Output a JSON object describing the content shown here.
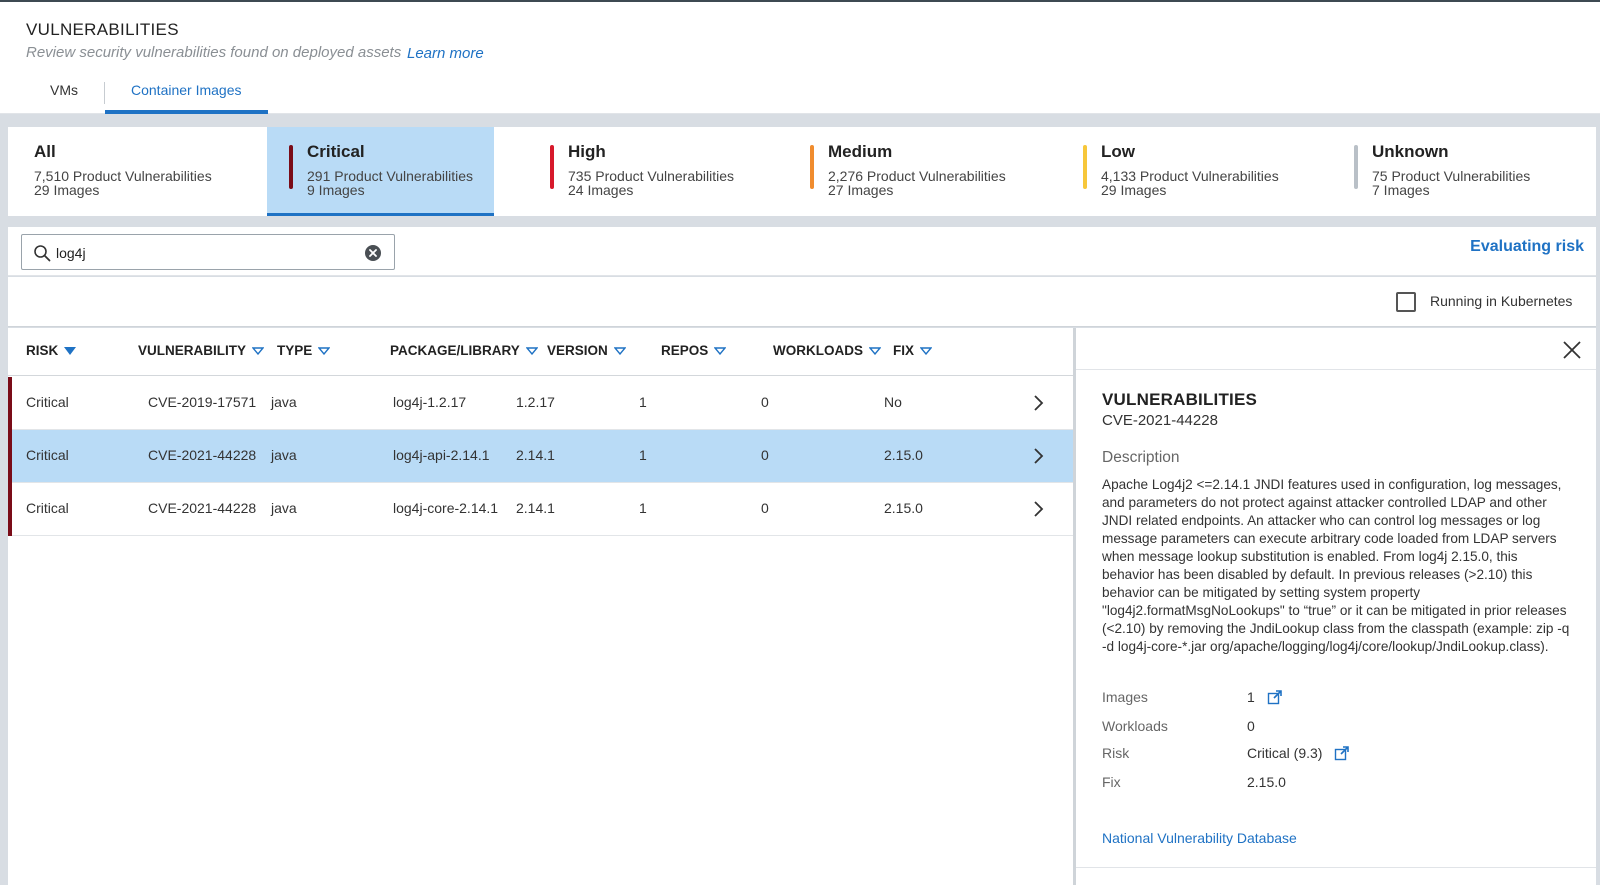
{
  "header": {
    "title": "VULNERABILITIES",
    "subtitle": "Review security vulnerabilities found on deployed assets",
    "learn_more": "Learn more"
  },
  "tabs": [
    {
      "label": "VMs",
      "active": false
    },
    {
      "label": "Container Images",
      "active": true
    }
  ],
  "severity_cards": [
    {
      "name": "All",
      "line1": "7,510 Product Vulnerabilities",
      "line2": "29 Images",
      "color": "",
      "selected": false
    },
    {
      "name": "Critical",
      "line1": "291 Product Vulnerabilities",
      "line2": "9 Images",
      "color": "#7a0c18",
      "selected": true
    },
    {
      "name": "High",
      "line1": "735 Product Vulnerabilities",
      "line2": "24 Images",
      "color": "#d7192b",
      "selected": false
    },
    {
      "name": "Medium",
      "line1": "2,276 Product Vulnerabilities",
      "line2": "27 Images",
      "color": "#f08c2e",
      "selected": false
    },
    {
      "name": "Low",
      "line1": "4,133 Product Vulnerabilities",
      "line2": "29 Images",
      "color": "#f7c73a",
      "selected": false
    },
    {
      "name": "Unknown",
      "line1": "75 Product Vulnerabilities",
      "line2": "7 Images",
      "color": "#b9c0c7",
      "selected": false
    }
  ],
  "search": {
    "value": "log4j",
    "placeholder": ""
  },
  "evaluating_risk": "Evaluating risk",
  "filters": {
    "running_in_kubernetes": "Running in Kubernetes"
  },
  "table": {
    "headers": {
      "risk": "RISK",
      "vulnerability": "VULNERABILITY",
      "type": "TYPE",
      "package": "PACKAGE/LIBRARY",
      "version": "VERSION",
      "repos": "REPOS",
      "workloads": "WORKLOADS",
      "fix": "FIX"
    },
    "rows": [
      {
        "risk": "Critical",
        "vulnerability": "CVE-2019-17571",
        "type": "java",
        "package": "log4j-1.2.17",
        "version": "1.2.17",
        "repos": "1",
        "workloads": "0",
        "fix": "No",
        "selected": false
      },
      {
        "risk": "Critical",
        "vulnerability": "CVE-2021-44228",
        "type": "java",
        "package": "log4j-api-2.14.1",
        "version": "2.14.1",
        "repos": "1",
        "workloads": "0",
        "fix": "2.15.0",
        "selected": true
      },
      {
        "risk": "Critical",
        "vulnerability": "CVE-2021-44228",
        "type": "java",
        "package": "log4j-core-2.14.1",
        "version": "2.14.1",
        "repos": "1",
        "workloads": "0",
        "fix": "2.15.0",
        "selected": false
      }
    ]
  },
  "details": {
    "title": "VULNERABILITIES",
    "cve": "CVE-2021-44228",
    "description_label": "Description",
    "description": "Apache Log4j2 <=2.14.1 JNDI features used in configuration, log messages, and parameters do not protect against attacker controlled LDAP and other JNDI related endpoints. An attacker who can control log messages or log message parameters can execute arbitrary code loaded from LDAP servers when message lookup substitution is enabled. From log4j 2.15.0, this behavior has been disabled by default. In previous releases (>2.10) this behavior can be mitigated by setting system property \"log4j2.formatMsgNoLookups\" to “true” or it can be mitigated in prior releases (<2.10) by removing the JndiLookup class from the classpath (example: zip -q -d log4j-core-*.jar org/apache/logging/log4j/core/lookup/JndiLookup.class).",
    "fields": [
      {
        "label": "Images",
        "value": "1"
      },
      {
        "label": "Workloads",
        "value": "0"
      },
      {
        "label": "Risk",
        "value": "Critical (9.3)"
      },
      {
        "label": "Fix",
        "value": "2.15.0"
      }
    ],
    "nvd_link": "National Vulnerability Database"
  },
  "colors": {
    "accent": "#1f72c4",
    "selected_bg": "#b9dbf6",
    "critical": "#7a0c18"
  }
}
